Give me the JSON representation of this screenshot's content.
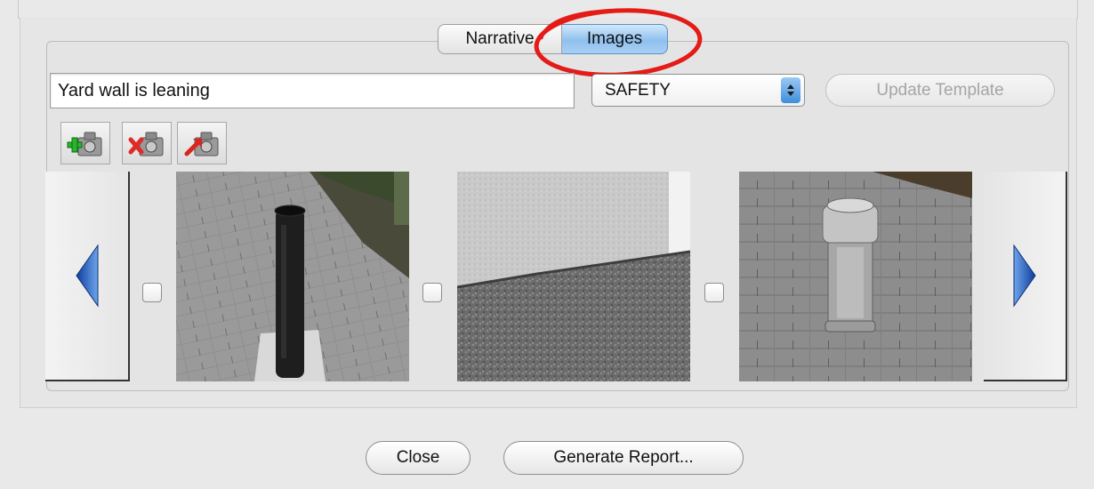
{
  "tabs": [
    {
      "label": "Narrative",
      "selected": false
    },
    {
      "label": "Images",
      "selected": true
    }
  ],
  "item": {
    "title_value": "Yard wall is leaning",
    "category_value": "SAFETY",
    "update_template_label": "Update Template",
    "update_template_enabled": false
  },
  "image_toolbar": {
    "icons": [
      "add-image-icon",
      "delete-image-icon",
      "export-image-icon"
    ]
  },
  "gallery": {
    "prev_icon": "arrow-left-icon",
    "next_icon": "arrow-right-icon",
    "images": [
      {
        "subject": "black plumbing vent pipe on shingle roof",
        "checked": false
      },
      {
        "subject": "stucco wall meeting shingle roof",
        "checked": false
      },
      {
        "subject": "metal vent pipe with cap on shingle roof",
        "checked": false
      }
    ]
  },
  "footer": {
    "close_label": "Close",
    "generate_label": "Generate Report..."
  },
  "colors": {
    "annotation_circle": "#e41b17",
    "selected_tab": "#8fc0ee",
    "nav_arrow": "#2f6fd0"
  }
}
